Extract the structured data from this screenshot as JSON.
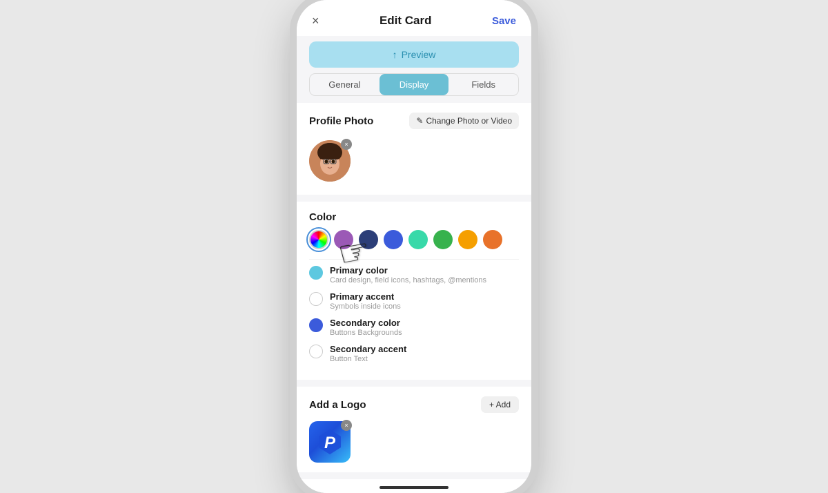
{
  "header": {
    "close_icon": "×",
    "title": "Edit Card",
    "save_label": "Save"
  },
  "preview": {
    "icon": "↑",
    "label": "Preview"
  },
  "tabs": [
    {
      "id": "general",
      "label": "General",
      "active": false
    },
    {
      "id": "display",
      "label": "Display",
      "active": true
    },
    {
      "id": "fields",
      "label": "Fields",
      "active": false
    }
  ],
  "profile_photo": {
    "section_title": "Profile Photo",
    "change_btn_icon": "✎",
    "change_btn_label": "Change Photo or Video"
  },
  "color": {
    "section_title": "Color",
    "swatches": [
      {
        "id": "rainbow",
        "type": "rainbow",
        "selected": true
      },
      {
        "id": "purple",
        "color": "#9b59b6"
      },
      {
        "id": "navy",
        "color": "#2c3e78"
      },
      {
        "id": "blue",
        "color": "#3b5bdb"
      },
      {
        "id": "teal",
        "color": "#38d9a9"
      },
      {
        "id": "green",
        "color": "#37b24d"
      },
      {
        "id": "yellow",
        "color": "#f59f00"
      },
      {
        "id": "orange",
        "color": "#e8722a"
      }
    ],
    "roles": [
      {
        "id": "primary-color",
        "name": "Primary color",
        "desc": "Card design, field icons, hashtags, @mentions",
        "dot_color": "#5dc8e0",
        "dot_border": "#5dc8e0"
      },
      {
        "id": "primary-accent",
        "name": "Primary accent",
        "desc": "Symbols inside icons",
        "dot_color": "#ffffff",
        "dot_border": "#ccc"
      },
      {
        "id": "secondary-color",
        "name": "Secondary color",
        "desc": "Buttons Backgrounds",
        "dot_color": "#3b5bdb",
        "dot_border": "#3b5bdb"
      },
      {
        "id": "secondary-accent",
        "name": "Secondary accent",
        "desc": "Button Text",
        "dot_color": "#ffffff",
        "dot_border": "#ccc"
      }
    ]
  },
  "logo": {
    "section_title": "Add a Logo",
    "add_btn_label": "+ Add",
    "logo_letter": "P"
  }
}
